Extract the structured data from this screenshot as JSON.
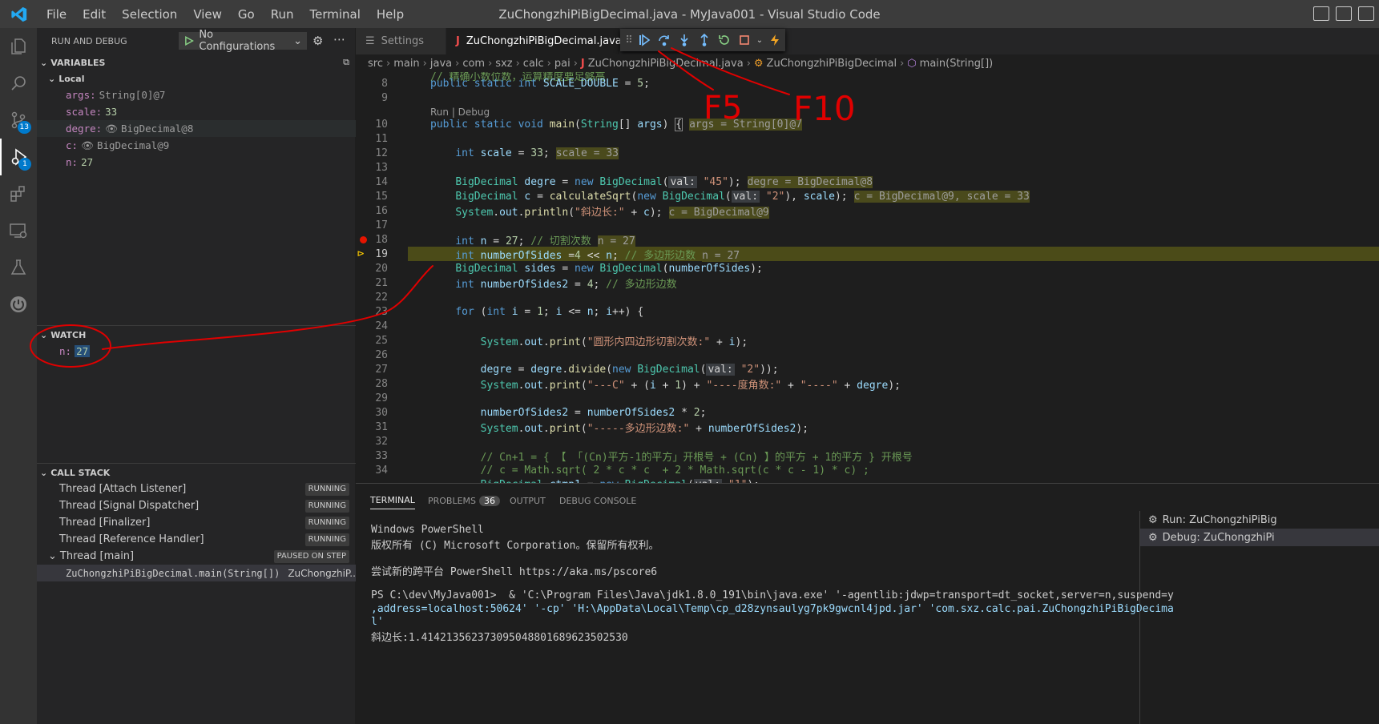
{
  "window": {
    "title": "ZuChongzhiPiBigDecimal.java - MyJava001 - Visual Studio Code",
    "menu": [
      "File",
      "Edit",
      "Selection",
      "View",
      "Go",
      "Run",
      "Terminal",
      "Help"
    ]
  },
  "activity": {
    "scm_badge": "13",
    "debug_badge": "1"
  },
  "sidebar": {
    "header": "RUN AND DEBUG",
    "config": "No Configurations",
    "variables_title": "VARIABLES",
    "local_title": "Local",
    "locals": [
      {
        "name": "args:",
        "value": "String[0]@7"
      },
      {
        "name": "scale:",
        "value": "33"
      },
      {
        "name": "degre:",
        "value": "BigDecimal@8"
      },
      {
        "name": "c:",
        "value": "BigDecimal@9"
      },
      {
        "name": "n:",
        "value": "27"
      }
    ],
    "watch_title": "WATCH",
    "watch": [
      {
        "name": "n:",
        "value": "27"
      }
    ],
    "callstack_title": "CALL STACK",
    "threads": [
      {
        "name": "Thread [Attach Listener]",
        "state": "RUNNING"
      },
      {
        "name": "Thread [Signal Dispatcher]",
        "state": "RUNNING"
      },
      {
        "name": "Thread [Finalizer]",
        "state": "RUNNING"
      },
      {
        "name": "Thread [Reference Handler]",
        "state": "RUNNING"
      },
      {
        "name": "Thread [main]",
        "state": "PAUSED ON STEP"
      }
    ],
    "frame": {
      "name": "ZuChongzhiPiBigDecimal.main(String[])",
      "file": "ZuChongzhiP..."
    }
  },
  "tabs": [
    {
      "label": "Settings"
    },
    {
      "label": "ZuChongzhiPiBigDecimal.java"
    }
  ],
  "breadcrumb": [
    "src",
    "main",
    "java",
    "com",
    "sxz",
    "calc",
    "pai",
    "ZuChongzhiPiBigDecimal.java",
    "ZuChongzhiPiBigDecimal",
    "main(String[])"
  ],
  "editor": {
    "codelens": "Run | Debug",
    "line_numbers": [
      "8",
      "9",
      "10",
      "11",
      "12",
      "13",
      "14",
      "15",
      "16",
      "17",
      "18",
      "19",
      "20",
      "21",
      "22",
      "23",
      "24",
      "25",
      "26",
      "27",
      "28",
      "29",
      "30",
      "31",
      "32",
      "33",
      "34"
    ],
    "current_line": "19",
    "breakpoint_line": "18",
    "inline_values": {
      "l10": "args = String[0]@7",
      "l12": "scale = 33",
      "l14": "degre = BigDecimal@8",
      "l15": "c = BigDecimal@9, scale = 33",
      "l16": "c = BigDecimal@9",
      "l18": "n = 27",
      "l19": "n = 27"
    }
  },
  "panel": {
    "tabs": [
      "TERMINAL",
      "PROBLEMS",
      "OUTPUT",
      "DEBUG CONSOLE"
    ],
    "problems_count": "36",
    "terminal_lines": [
      "Windows PowerShell",
      "版权所有 (C) Microsoft Corporation。保留所有权利。",
      "尝试新的跨平台 PowerShell https://aka.ms/pscore6",
      "PS C:\\dev\\MyJava001>  & 'C:\\Program Files\\Java\\jdk1.8.0_191\\bin\\java.exe' '-agentlib:jdwp=transport=dt_socket,server=n,suspend=y",
      ",address=localhost:50624' '-cp' 'H:\\AppData\\Local\\Temp\\cp_d28zynsaulyg7pk9gwcnl4jpd.jar' 'com.sxz.calc.pai.ZuChongzhiPiBigDecima",
      "l'",
      "斜边长:1.4142135623730950488016896235025​30"
    ],
    "terminals": [
      "Run: ZuChongzhiPiBig",
      "Debug: ZuChongzhiPi"
    ]
  },
  "annotations": {
    "f5": "F5",
    "f10": "F10",
    "color": "#e00000"
  }
}
